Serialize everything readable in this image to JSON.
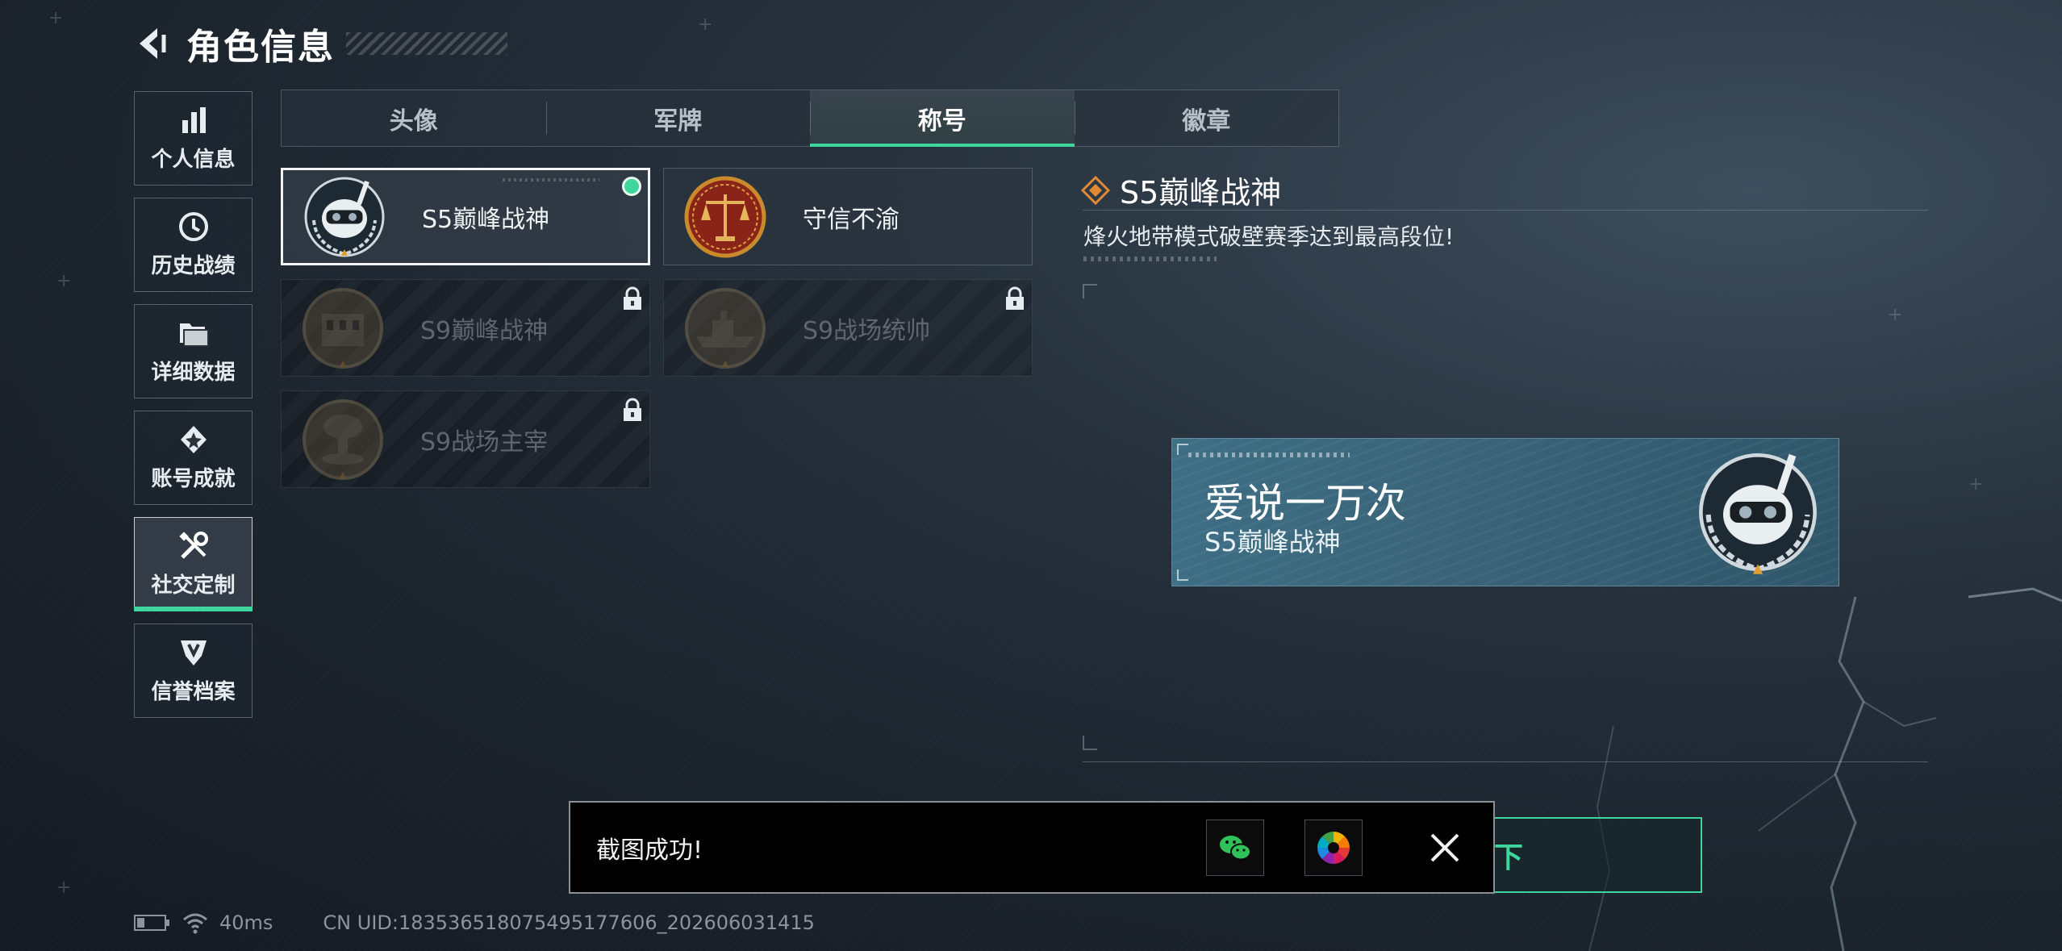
{
  "header": {
    "title": "角色信息"
  },
  "sidebar": {
    "items": [
      {
        "label": "个人信息",
        "icon": "bar-chart-icon",
        "active": false
      },
      {
        "label": "历史战绩",
        "icon": "history-clock-icon",
        "active": false
      },
      {
        "label": "详细数据",
        "icon": "folder-icon",
        "active": false
      },
      {
        "label": "账号成就",
        "icon": "achievement-badge-icon",
        "active": false
      },
      {
        "label": "社交定制",
        "icon": "tools-icon",
        "active": true
      },
      {
        "label": "信誉档案",
        "icon": "credit-shield-icon",
        "active": false
      }
    ]
  },
  "tabs": [
    {
      "label": "头像",
      "active": false
    },
    {
      "label": "军牌",
      "active": false
    },
    {
      "label": "称号",
      "active": true
    },
    {
      "label": "徽章",
      "active": false
    }
  ],
  "titles": [
    {
      "label": "S5巅峰战神",
      "emblem": "diver-skull-emblem",
      "state": "equipped"
    },
    {
      "label": "守信不渝",
      "emblem": "scales-emblem",
      "state": "owned"
    },
    {
      "label": "S9巅峰战神",
      "emblem": "ruins-emblem",
      "state": "locked"
    },
    {
      "label": "S9战场统帅",
      "emblem": "warship-emblem",
      "state": "locked"
    },
    {
      "label": "S9战场主宰",
      "emblem": "mushroom-cloud-emblem",
      "state": "locked"
    }
  ],
  "detail": {
    "title": "S5巅峰战神",
    "description": "烽火地带模式破壁赛季达到最高段位!"
  },
  "preview": {
    "player_name": "爱说一万次",
    "title": "S5巅峰战神"
  },
  "action_button": {
    "label": "卸下"
  },
  "toast": {
    "message": "截图成功!",
    "share_icons": [
      "wechat-icon",
      "photos-icon"
    ]
  },
  "status": {
    "ping": "40ms",
    "uid": "CN UID:18353651807549517​7606_202606031415"
  },
  "colors": {
    "accent": "#3ed69c",
    "emblem_gold": "#c98a2b",
    "scales_red": "#8a2418"
  }
}
